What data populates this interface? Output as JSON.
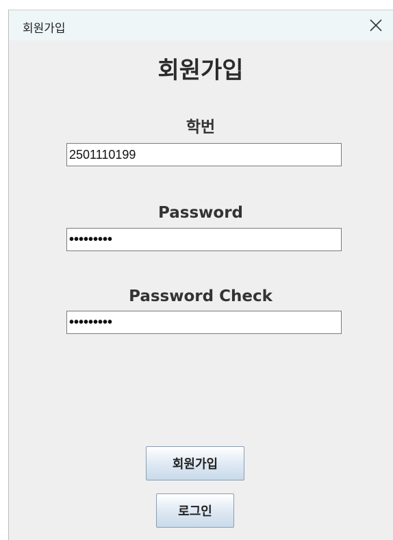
{
  "window": {
    "title": "회원가입",
    "close_icon": "close-icon"
  },
  "form": {
    "heading": "회원가입",
    "student_id": {
      "label": "학번",
      "value": "2501110199"
    },
    "password": {
      "label": "Password",
      "masked_value": "•••••••••"
    },
    "password_check": {
      "label": "Password Check",
      "masked_value": "•••••••••"
    }
  },
  "buttons": {
    "signup_label": "회원가입",
    "login_label": "로그인"
  },
  "colors": {
    "titlebar_bg": "#eef6f8",
    "window_bg": "#efefef",
    "button_gradient_bottom": "#c9daea"
  }
}
